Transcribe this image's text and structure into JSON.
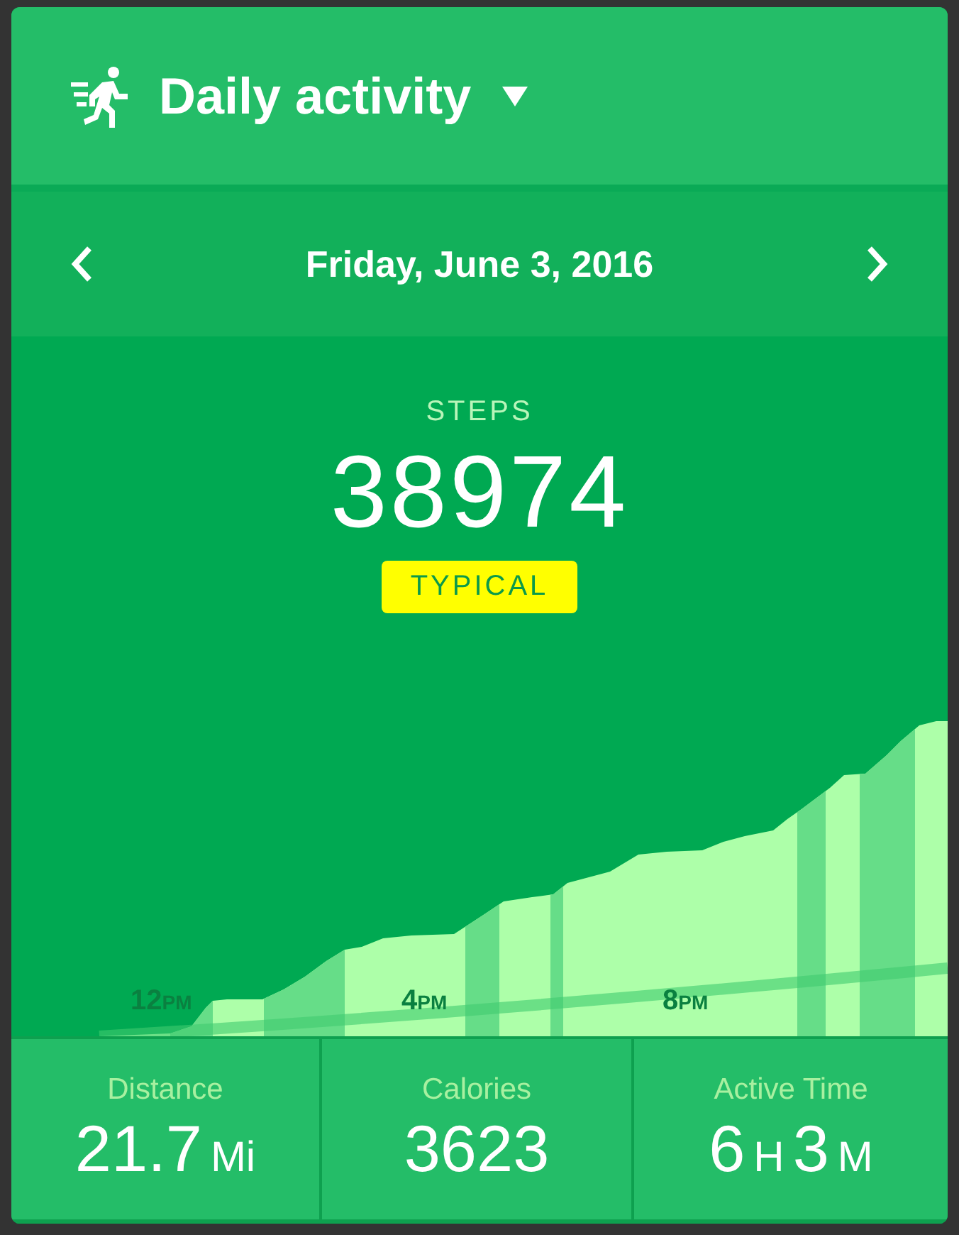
{
  "header": {
    "title": "Daily activity"
  },
  "date_nav": {
    "date": "Friday, June 3, 2016"
  },
  "summary": {
    "label": "STEPS",
    "value": "38974",
    "badge": "TYPICAL"
  },
  "chart": {
    "time_labels": [
      {
        "hour": "12",
        "suffix": "PM"
      },
      {
        "hour": "4",
        "suffix": "PM"
      },
      {
        "hour": "8",
        "suffix": "PM"
      }
    ]
  },
  "stats": [
    {
      "label": "Distance",
      "parts": [
        {
          "text": "21.7",
          "kind": "number"
        },
        {
          "text": "Mi",
          "kind": "unit"
        }
      ]
    },
    {
      "label": "Calories",
      "parts": [
        {
          "text": "3623",
          "kind": "number"
        }
      ]
    },
    {
      "label": "Active Time",
      "parts": [
        {
          "text": "6",
          "kind": "number"
        },
        {
          "text": "H",
          "kind": "unit"
        },
        {
          "text": "3",
          "kind": "number"
        },
        {
          "text": "M",
          "kind": "unit"
        }
      ]
    }
  ]
}
